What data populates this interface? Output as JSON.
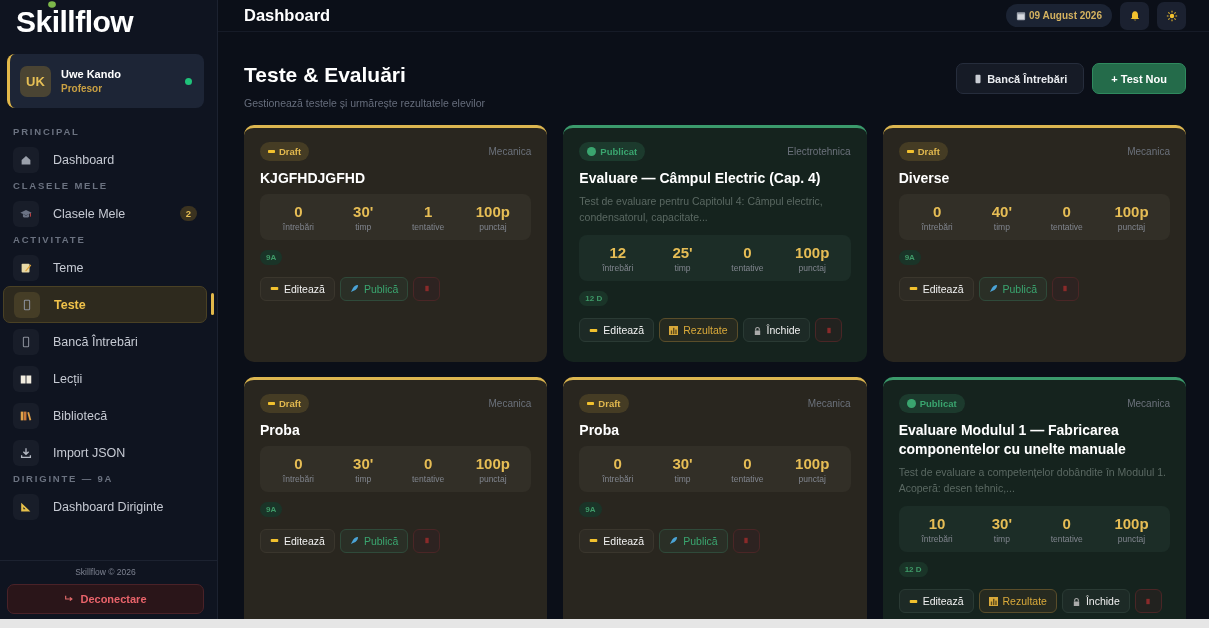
{
  "brand": {
    "name": "Skillflow"
  },
  "user": {
    "initials": "UK",
    "name": "Uwe Kando",
    "role": "Profesor",
    "online": true
  },
  "nav_sections": [
    {
      "label": "PRINCIPAL",
      "items": [
        {
          "label": "Dashboard",
          "selected": false
        }
      ]
    },
    {
      "label": "CLASELE MELE",
      "items": [
        {
          "label": "Clasele Mele",
          "badge": "2",
          "selected": false
        }
      ]
    },
    {
      "label": "ACTIVITATE",
      "items": [
        {
          "label": "Teme",
          "selected": false
        },
        {
          "label": "Teste",
          "selected": true
        },
        {
          "label": "Bancă Întrebări",
          "selected": false
        },
        {
          "label": "Lecții",
          "selected": false
        },
        {
          "label": "Bibliotecă",
          "selected": false
        },
        {
          "label": "Import JSON",
          "selected": false
        }
      ]
    },
    {
      "label": "DIRIGINTE — 9A",
      "items": [
        {
          "label": "Dashboard Diriginte",
          "selected": false
        }
      ]
    }
  ],
  "footer": {
    "copyright": "Skillflow © 2026",
    "logout": "Deconectare"
  },
  "header": {
    "title": "Dashboard",
    "date": "09 August 2026"
  },
  "page": {
    "title": "Teste & Evaluări",
    "subtitle": "Gestionează testele și urmărește rezultatele elevilor",
    "buttons": [
      {
        "kind": "secondary",
        "label": "Bancă Întrebări"
      },
      {
        "kind": "primary",
        "label": "+ Test Nou"
      }
    ]
  },
  "tests": [
    {
      "kind": "draft",
      "status_label": "Draft",
      "subject": "Mecanica",
      "title": "KJGFHDJGFHD",
      "stats": [
        {
          "value": "0",
          "label": "întrebări"
        },
        {
          "value": "30'",
          "label": "timp"
        },
        {
          "value": "1",
          "label": "tentative"
        },
        {
          "value": "100p",
          "label": "punctaj"
        }
      ],
      "class": "9A",
      "actions": [
        {
          "kind": "edit",
          "label": "Editează"
        },
        {
          "kind": "publish",
          "label": "Publică"
        },
        {
          "kind": "delete"
        }
      ]
    },
    {
      "kind": "published",
      "status_label": "Publicat",
      "subject": "Electrotehnica",
      "title": "Evaluare — Câmpul Electric (Cap. 4)",
      "description": "Test de evaluare pentru Capitolul 4: Câmpul electric, condensatorul, capacitate...",
      "stats": [
        {
          "value": "12",
          "label": "întrebări"
        },
        {
          "value": "25'",
          "label": "timp"
        },
        {
          "value": "0",
          "label": "tentative"
        },
        {
          "value": "100p",
          "label": "punctaj"
        }
      ],
      "class": "12 D",
      "actions": [
        {
          "kind": "edit",
          "label": "Editează"
        },
        {
          "kind": "results",
          "label": "Rezultate"
        },
        {
          "kind": "close",
          "label": "Închide"
        },
        {
          "kind": "delete"
        }
      ]
    },
    {
      "kind": "draft",
      "status_label": "Draft",
      "subject": "Mecanica",
      "title": "Diverse",
      "stats": [
        {
          "value": "0",
          "label": "întrebări"
        },
        {
          "value": "40'",
          "label": "timp"
        },
        {
          "value": "0",
          "label": "tentative"
        },
        {
          "value": "100p",
          "label": "punctaj"
        }
      ],
      "class": "9A",
      "actions": [
        {
          "kind": "edit",
          "label": "Editează"
        },
        {
          "kind": "publish",
          "label": "Publică"
        },
        {
          "kind": "delete"
        }
      ]
    },
    {
      "kind": "draft",
      "status_label": "Draft",
      "subject": "Mecanica",
      "title": "Proba",
      "stats": [
        {
          "value": "0",
          "label": "întrebări"
        },
        {
          "value": "30'",
          "label": "timp"
        },
        {
          "value": "0",
          "label": "tentative"
        },
        {
          "value": "100p",
          "label": "punctaj"
        }
      ],
      "class": "9A",
      "actions": [
        {
          "kind": "edit",
          "label": "Editează"
        },
        {
          "kind": "publish",
          "label": "Publică"
        },
        {
          "kind": "delete"
        }
      ]
    },
    {
      "kind": "draft",
      "status_label": "Draft",
      "subject": "Mecanica",
      "title": "Proba",
      "stats": [
        {
          "value": "0",
          "label": "întrebări"
        },
        {
          "value": "30'",
          "label": "timp"
        },
        {
          "value": "0",
          "label": "tentative"
        },
        {
          "value": "100p",
          "label": "punctaj"
        }
      ],
      "class": "9A",
      "actions": [
        {
          "kind": "edit",
          "label": "Editează"
        },
        {
          "kind": "publish",
          "label": "Publică"
        },
        {
          "kind": "delete"
        }
      ]
    },
    {
      "kind": "published",
      "status_label": "Publicat",
      "subject": "Mecanica",
      "title": "Evaluare Modulul 1 — Fabricarea componentelor cu unelte manuale",
      "description": "Test de evaluare a competențelor dobândite în Modulul 1. Acoperă: desen tehnic,...",
      "stats": [
        {
          "value": "10",
          "label": "întrebări"
        },
        {
          "value": "30'",
          "label": "timp"
        },
        {
          "value": "0",
          "label": "tentative"
        },
        {
          "value": "100p",
          "label": "punctaj"
        }
      ],
      "class": "12 D",
      "actions": [
        {
          "kind": "edit",
          "label": "Editează"
        },
        {
          "kind": "results",
          "label": "Rezultate"
        },
        {
          "kind": "close",
          "label": "Închide"
        },
        {
          "kind": "delete"
        }
      ]
    }
  ]
}
